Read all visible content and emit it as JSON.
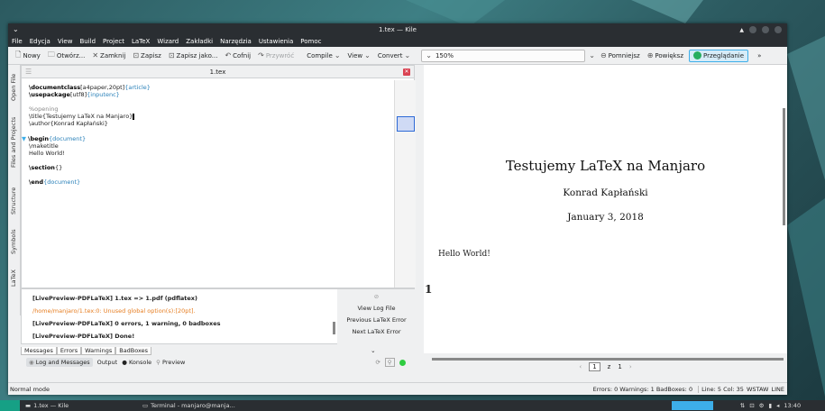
{
  "window": {
    "title": "1.tex — Kile"
  },
  "menu": [
    "File",
    "Edycja",
    "View",
    "Build",
    "Project",
    "LaTeX",
    "Wizard",
    "Zakładki",
    "Narzędzia",
    "Ustawienia",
    "Pomoc"
  ],
  "toolbar": {
    "new": "Nowy",
    "open": "Otwórz...",
    "close": "Zamknij",
    "save": "Zapisz",
    "save_as": "Zapisz jako...",
    "undo": "Cofnij",
    "redo": "Przywróć",
    "compile": "Compile",
    "view": "View",
    "convert": "Convert",
    "zoom": "150%",
    "zoom_out": "Pomniejsz",
    "zoom_in": "Powiększ",
    "browse": "Przeglądanie",
    "overflow": "»"
  },
  "sidetabs": [
    "Open File",
    "Files and Projects",
    "Structure",
    "Symbols",
    "LaTeX"
  ],
  "editor": {
    "tab": "1.tex",
    "lines": [
      {
        "cmd": "\\documentclass",
        "rest": "[a4paper,20pt]",
        "arg": "{article}"
      },
      {
        "cmd": "\\usepackage",
        "rest": "[utf8]",
        "arg": "{inputenc}"
      },
      {
        "blank": true
      },
      {
        "comment": "%opening"
      },
      {
        "cmd": "\\title",
        "rest": "{Testujemy LaTeX na Manjaro}",
        "arg": ""
      },
      {
        "cmd": "\\author",
        "rest": "{Konrad Kapłański}",
        "arg": ""
      },
      {
        "blank": true
      },
      {
        "cmd": "\\begin",
        "rest": "",
        "arg": "{document}"
      },
      {
        "cmd": "\\maketitle",
        "rest": "",
        "arg": ""
      },
      {
        "text": "Hello World!"
      },
      {
        "blank": true
      },
      {
        "cmd": "\\section",
        "rest": "{}",
        "arg": ""
      },
      {
        "blank": true
      },
      {
        "cmd": "\\end",
        "rest": "",
        "arg": "{document}"
      }
    ]
  },
  "messages": {
    "lines": [
      {
        "text": "[LivePreview-PDFLaTeX] 1.tex => 1.pdf (pdflatex)",
        "color": "#222"
      },
      {
        "text": "/home/manjaro/1.tex:0: Unused global option(s):[20pt].",
        "color": "#e67e22"
      },
      {
        "text": "[LivePreview-PDFLaTeX] 0 errors, 1 warning, 0 badboxes",
        "color": "#222"
      },
      {
        "text": "[LivePreview-PDFLaTeX] Done!",
        "color": "#222"
      }
    ],
    "buttons": [
      "View Log File",
      "Previous LaTeX Error",
      "Next LaTeX Error"
    ]
  },
  "bottom_tabs": [
    "Messages",
    "Errors",
    "Warnings",
    "BadBoxes"
  ],
  "panel_tabs": [
    "Log and Messages",
    "Output",
    "Konsole",
    "Preview"
  ],
  "pdf": {
    "title": "Testujemy LaTeX na Manjaro",
    "author": "Konrad Kapłański",
    "date": "January 3, 2018",
    "body": "Hello World!",
    "section": "1"
  },
  "pdfnav": {
    "page": "1",
    "sep": "z",
    "total": "1"
  },
  "status": {
    "mode": "Normal mode",
    "errors": "Errors: 0 Warnings: 1 BadBoxes: 0",
    "pos": "Line: 5 Col: 35",
    "ins": "WSTAW",
    "line": "LINE"
  },
  "taskbar": {
    "kile": "1.tex — Kile",
    "terminal": "Terminal - manjaro@manja...",
    "clock": "13:40"
  }
}
